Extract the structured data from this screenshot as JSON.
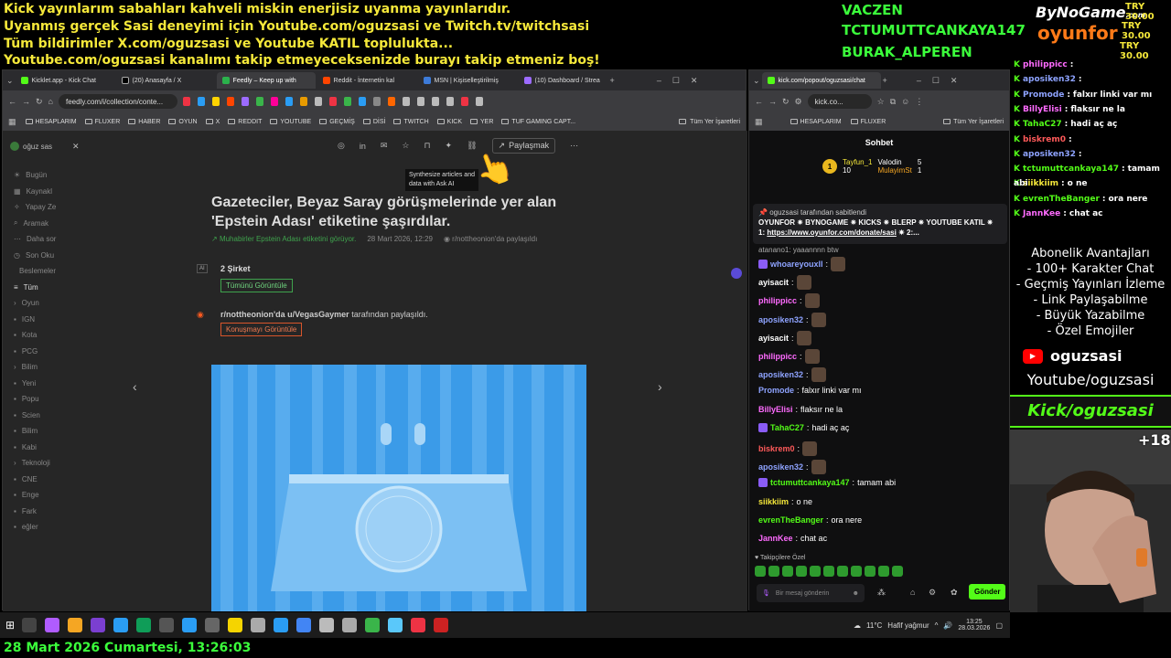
{
  "ticker": [
    "Kick yayınlarım sabahları kahveli miskin enerjisiz uyanma yayınlarıdır.",
    "Uyanmış gerçek Sasi deneyimi için Youtube.com/oguzsasi ve Twitch.tv/twitchsasi",
    "Tüm bildirimler X.com/oguzsasi ve Youtube KATIL toplulukta...",
    "Youtube.com/oguzsasi kanalımı takip etmeyeceksenizde burayı takip etmeniz boş!"
  ],
  "supporters": [
    "VACZEN",
    "TCTUMUTTCANKAYA147",
    "BURAK_ALPEREN"
  ],
  "sponsor": {
    "top": "ByNoGame",
    "small": ".com",
    "bottom": "oyunfor"
  },
  "try": [
    "TRY 30.00",
    "TRY 30.00",
    "TRY 30.00"
  ],
  "browser_left": {
    "tabs": [
      "Kicklet.app - Kick Chat",
      "(20) Anasayfa / X",
      "Feedly – Keep up with",
      "Reddit - İnternetin kal",
      "MSN | Kişiselleştirilmiş",
      "(10) Dashboard / Strea"
    ],
    "url": "feedly.com/i/collection/conte...",
    "bookmarks": [
      "HESAPLARIM",
      "FLUXER",
      "HABER",
      "OYUN",
      "X",
      "REDDIT",
      "YOUTUBE",
      "GEÇMİŞ",
      "DİSİ",
      "TWITCH",
      "KICK",
      "YER",
      "TUF GAMING CAPT..."
    ],
    "all_bookmarks": "Tüm Yer İşaretleri"
  },
  "feedly": {
    "user": "oğuz sas",
    "side_items": [
      "Bugün",
      "Kaynakl",
      "Yapay Ze",
      "Aramak",
      "Daha sor",
      "Son Oku",
      "Beslemeler",
      "Tüm",
      "Oyun",
      "IGN",
      "Kota",
      "PCG",
      "Bilim",
      "Yeni",
      "Popu",
      "Scien",
      "Bilim",
      "Kabi",
      "Teknoloji",
      "CNE",
      "Enge",
      "Fark",
      "eğler"
    ],
    "share": "Paylaşmak",
    "tooltip": "Synthesize articles and data with Ask AI",
    "title": "Gazeteciler, Beyaz Saray görüşmelerinde yer alan 'Epstein Adası' etiketine şaşırdılar.",
    "meta_trend": "Muhabirler Epstein Adası etiketini görüyor.",
    "meta_date": "28 Mart 2026, 12:29",
    "meta_source": "r/nottheonion'da paylaşıldı",
    "ai_label": "AI",
    "companies": "2 Şirket",
    "view_all": "Tümünü Görüntüle",
    "shared_by_prefix": "r/nottheonion'da u/VegasGaymer",
    "shared_by_suffix": "tarafından paylaşıldı.",
    "view_conv": "Konuşmayı Görüntüle"
  },
  "browser_right": {
    "tab": "kick.com/popout/oguzsasi/chat",
    "url": "kick.co...",
    "bookmarks": [
      "HESAPLARIM",
      "FLUXER"
    ],
    "all_bookmarks": "Tüm Yer İşaretleri"
  },
  "kick_chat": {
    "header": "Sohbet",
    "leaders": [
      {
        "rank": "1",
        "name": "Tayfun_1",
        "count": "10"
      },
      {
        "rank": "",
        "name": "Valodin",
        "count": "5"
      },
      {
        "rank": "",
        "name": "MulayimSt",
        "count": "1"
      }
    ],
    "pinned_by": "oguzsasi tarafından sabitlendi",
    "pinned_line1": "OYUNFOR ✷ BYNOGAME ✷ KICKS ✷ BLERP ✷ YOUTUBE KATIL ✷",
    "pinned_line2_prefix": "1:",
    "pinned_link": "https://www.oyunfor.com/donate/sasi",
    "pinned_line2_suffix": "✷ 2:...",
    "cut_top": "atanano1: yaaannnn btw",
    "messages": [
      {
        "user": "whoareyouxll",
        "color": "#8ea3ff",
        "text": "",
        "emote": true,
        "badge": true
      },
      {
        "user": "ayisacit",
        "color": "#ffffff",
        "text": "",
        "emote": true,
        "badge": false
      },
      {
        "user": "philippicc",
        "color": "#ff6bff",
        "text": "",
        "emote": true,
        "badge": false
      },
      {
        "user": "aposiken32",
        "color": "#8ea3ff",
        "text": "",
        "emote": true,
        "badge": false
      },
      {
        "user": "ayisacit",
        "color": "#ffffff",
        "text": "",
        "emote": true,
        "badge": false
      },
      {
        "user": "philippicc",
        "color": "#ff6bff",
        "text": "",
        "emote": true,
        "badge": false
      },
      {
        "user": "aposiken32",
        "color": "#8ea3ff",
        "text": "",
        "emote": true,
        "badge": false
      },
      {
        "user": "Promode",
        "color": "#8ea3ff",
        "text": "falxır linki var mı",
        "emote": false,
        "badge": false
      },
      {
        "user": "BillyElisi",
        "color": "#ff6bff",
        "text": "flaksır ne la",
        "emote": false,
        "badge": false
      },
      {
        "user": "TahaC27",
        "color": "#53fc18",
        "text": "hadi aç aç",
        "emote": false,
        "badge": true
      },
      {
        "user": "biskrem0",
        "color": "#ff5a5a",
        "text": "",
        "emote": true,
        "badge": false
      },
      {
        "user": "aposiken32",
        "color": "#8ea3ff",
        "text": "",
        "emote": true,
        "badge": false
      },
      {
        "user": "tctumuttcankaya147",
        "color": "#53fc18",
        "text": "tamam abi",
        "emote": false,
        "badge": true
      },
      {
        "user": "siikkiim",
        "color": "#f5e83a",
        "text": "o ne",
        "emote": false,
        "badge": false
      },
      {
        "user": "evrenTheBanger",
        "color": "#53fc18",
        "text": "ora nere",
        "emote": false,
        "badge": false
      },
      {
        "user": "JannKee",
        "color": "#ff6bff",
        "text": "chat ac",
        "emote": false,
        "badge": false
      }
    ],
    "followers_only": "Takipçilere Özel",
    "input_placeholder": "Bir mesaj gönderin",
    "send": "Gönder"
  },
  "overlay_chat": [
    {
      "user": "philippicc",
      "color": "#ff6bff",
      "text": ""
    },
    {
      "user": "aposiken32",
      "color": "#8ea3ff",
      "text": ""
    },
    {
      "user": "Promode",
      "color": "#8ea3ff",
      "text": "falxır linki var mı"
    },
    {
      "user": "BillyElisi",
      "color": "#ff6bff",
      "text": "flaksır ne la"
    },
    {
      "user": "TahaC27",
      "color": "#53fc18",
      "text": "hadi aç aç"
    },
    {
      "user": "biskrem0",
      "color": "#ff5a5a",
      "text": ""
    },
    {
      "user": "aposiken32",
      "color": "#8ea3ff",
      "text": ""
    },
    {
      "user": "tctumuttcankaya147",
      "color": "#53fc18",
      "text": "tamam"
    },
    {
      "user": "siikkiim",
      "color": "#f5e83a",
      "text": "o ne"
    },
    {
      "user": "evrenTheBanger",
      "color": "#53fc18",
      "text": "ora nere"
    },
    {
      "user": "JannKee",
      "color": "#ff6bff",
      "text": "chat ac"
    }
  ],
  "overlay_wrap": "abi",
  "perks": [
    "Abonelik Avantajları",
    "- 100+ Karakter Chat",
    "- Geçmiş Yayınları İzleme",
    "- Link Paylaşabilme",
    "- Büyük Yazabilme",
    "- Özel Emojiler"
  ],
  "youtube_handle": "oguzsasi",
  "youtube_url": "Youtube/oguzsasi",
  "kick_handle": "Kick/oguzsasi",
  "plus_count": "+18",
  "taskbar": {
    "weather": "11°C",
    "weather_desc": "Hafif yağmur",
    "time": "13:25",
    "date": "28.03.2026"
  },
  "footer_date": "28 Mart 2026 Cumartesi, 13:26:03",
  "colors": {
    "kick_green": "#53fc18",
    "ticker_yellow": "#f5e83a",
    "feedly_blue": "#3b9be8"
  }
}
